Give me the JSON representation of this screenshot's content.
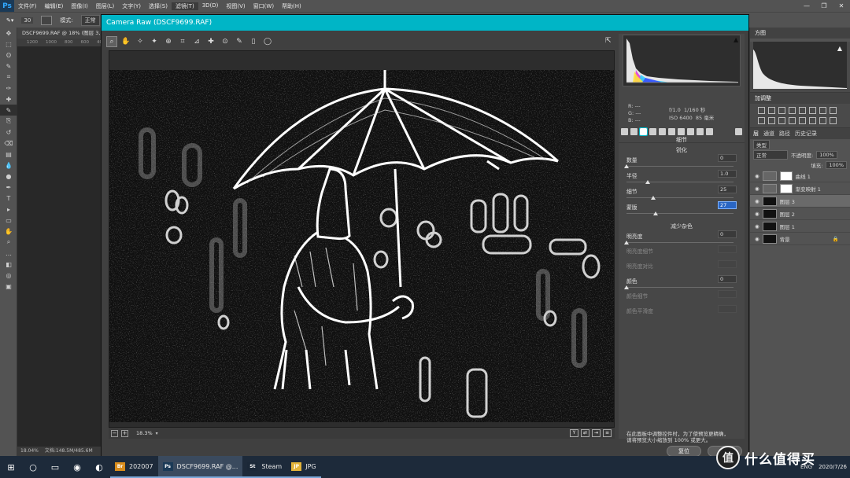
{
  "ps": {
    "logo": "Ps",
    "menus": [
      "文件(F)",
      "编辑(E)",
      "图像(I)",
      "图层(L)",
      "文字(Y)",
      "选择(S)",
      "滤镜(T)",
      "3D(D)",
      "视图(V)",
      "窗口(W)",
      "帮助(H)"
    ],
    "active_menu": 6,
    "options": {
      "brush_size": "30",
      "mode_label": "模式:",
      "mode_value": "正常"
    },
    "document_tab": "DSCF9699.RAF @ 18% (图层 3, R",
    "ruler": [
      "1200",
      "1000",
      "800",
      "600",
      "400"
    ],
    "status": {
      "zoom": "18.04%",
      "doc": "文档:148.5M/485.6M"
    },
    "tools": [
      "move",
      "marquee",
      "lasso",
      "quick-select",
      "crop",
      "eyedropper",
      "healing",
      "brush",
      "clone",
      "history-brush",
      "eraser",
      "gradient",
      "blur",
      "dodge",
      "pen",
      "type",
      "path-select",
      "shape",
      "hand",
      "zoom",
      "more",
      "colors",
      "quickmask",
      "screen-mode"
    ]
  },
  "rpanel": {
    "histogram_tab": "方图",
    "adjust_label": "加调整",
    "layer_tabs": [
      "层",
      "通道",
      "路径",
      "历史记录"
    ],
    "kind": "类型",
    "blend": "正常",
    "opacity_label": "不透明度:",
    "opacity": "100%",
    "fill_label": "填充:",
    "fill": "100%",
    "layers": [
      {
        "name": "曲线 1",
        "type": "adjust"
      },
      {
        "name": "渐变映射 1",
        "type": "adjust"
      },
      {
        "name": "图层 3",
        "type": "image",
        "selected": true
      },
      {
        "name": "图层 2",
        "type": "image"
      },
      {
        "name": "图层 1",
        "type": "image"
      },
      {
        "name": "背景",
        "type": "image",
        "locked": true
      }
    ]
  },
  "acr": {
    "title": "Camera Raw (DSCF9699.RAF)",
    "tools": [
      "zoom-icon",
      "hand-icon",
      "white-balance-icon",
      "color-sampler-icon",
      "target-adjust-icon",
      "crop-icon",
      "straighten-icon",
      "spot-removal-icon",
      "redeye-icon",
      "adjustment-brush-icon",
      "graduated-filter-icon",
      "radial-filter-icon"
    ],
    "rgb": {
      "r": "R:",
      "g": "G:",
      "b": "B:",
      "dash": "---"
    },
    "exif": {
      "aperture": "f/1.0",
      "shutter": "1/160 秒",
      "iso": "ISO 6400",
      "focal": "85 毫米"
    },
    "panel_title": "细节",
    "sharpen_title": "锐化",
    "sliders_sharpen": [
      {
        "label": "数量",
        "value": "0",
        "pos": 0.0
      },
      {
        "label": "半径",
        "value": "1.0",
        "pos": 0.2
      },
      {
        "label": "细节",
        "value": "25",
        "pos": 0.25
      },
      {
        "label": "蒙版",
        "value": "27",
        "pos": 0.27,
        "focus": true
      }
    ],
    "nr_title": "减少杂色",
    "sliders_nr": [
      {
        "label": "明亮度",
        "value": "0",
        "pos": 0.0,
        "disabled": false
      },
      {
        "label": "明亮度细节",
        "value": "",
        "pos": 0.5,
        "disabled": true
      },
      {
        "label": "明亮度对比",
        "value": "",
        "pos": 0.0,
        "disabled": true
      },
      {
        "label": "颜色",
        "value": "0",
        "pos": 0.0,
        "disabled": false
      },
      {
        "label": "颜色细节",
        "value": "",
        "pos": 0.5,
        "disabled": true
      },
      {
        "label": "颜色平滑度",
        "value": "",
        "pos": 0.5,
        "disabled": true
      }
    ],
    "hint_line1": "在此面板中调整控件时，为了使预览更精确，",
    "hint_line2": "请将预览大小缩放到 100% 或更大。",
    "zoom": "18.3%",
    "reset_label": "复位",
    "done_label": "完成"
  },
  "taskbar": {
    "apps": [
      {
        "label": "202007",
        "icon": "Br",
        "color": "#d88c1c"
      },
      {
        "label": "DSCF9699.RAF @...",
        "icon": "Ps",
        "color": "#1b3a57",
        "active": true
      },
      {
        "label": "Steam",
        "icon": "St",
        "color": "#1b2838"
      },
      {
        "label": "JPG",
        "icon": "JP",
        "color": "#e2b33a"
      }
    ],
    "ime": "ENG",
    "date": "2020/7/26",
    "watermark": "什么值得买",
    "watermark_badge": "值"
  }
}
